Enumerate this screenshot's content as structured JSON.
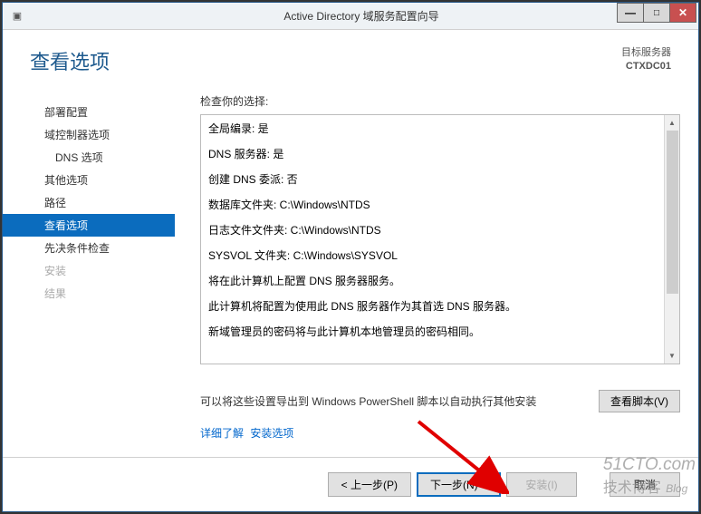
{
  "window": {
    "title": "Active Directory 域服务配置向导"
  },
  "header": {
    "page_title": "查看选项",
    "target_label": "目标服务器",
    "target_name": "CTXDC01"
  },
  "sidebar": {
    "items": [
      {
        "label": "部署配置",
        "indent": false,
        "active": false,
        "disabled": false
      },
      {
        "label": "域控制器选项",
        "indent": false,
        "active": false,
        "disabled": false
      },
      {
        "label": "DNS 选项",
        "indent": true,
        "active": false,
        "disabled": false
      },
      {
        "label": "其他选项",
        "indent": false,
        "active": false,
        "disabled": false
      },
      {
        "label": "路径",
        "indent": false,
        "active": false,
        "disabled": false
      },
      {
        "label": "查看选项",
        "indent": false,
        "active": true,
        "disabled": false
      },
      {
        "label": "先决条件检查",
        "indent": false,
        "active": false,
        "disabled": false
      },
      {
        "label": "安装",
        "indent": false,
        "active": false,
        "disabled": true
      },
      {
        "label": "结果",
        "indent": false,
        "active": false,
        "disabled": true
      }
    ]
  },
  "main": {
    "prompt": "检查你的选择:",
    "review_lines": [
      "全局编录: 是",
      "DNS 服务器: 是",
      "创建 DNS 委派: 否",
      "数据库文件夹: C:\\Windows\\NTDS",
      "日志文件文件夹: C:\\Windows\\NTDS",
      "SYSVOL 文件夹: C:\\Windows\\SYSVOL",
      "将在此计算机上配置 DNS 服务器服务。",
      "此计算机将配置为使用此 DNS 服务器作为其首选 DNS 服务器。",
      "新域管理员的密码将与此计算机本地管理员的密码相同。"
    ],
    "export_text": "可以将这些设置导出到 Windows PowerShell 脚本以自动执行其他安装",
    "view_script_btn": "查看脚本(V)",
    "more_link_1": "详细了解",
    "more_link_2": "安装选项"
  },
  "footer": {
    "prev": "< 上一步(P)",
    "next": "下一步(N) >",
    "install": "安装(I)",
    "cancel": "取消"
  },
  "watermark": {
    "en": "51CTO.com",
    "cn": "技术博客",
    "blog": "Blog"
  }
}
